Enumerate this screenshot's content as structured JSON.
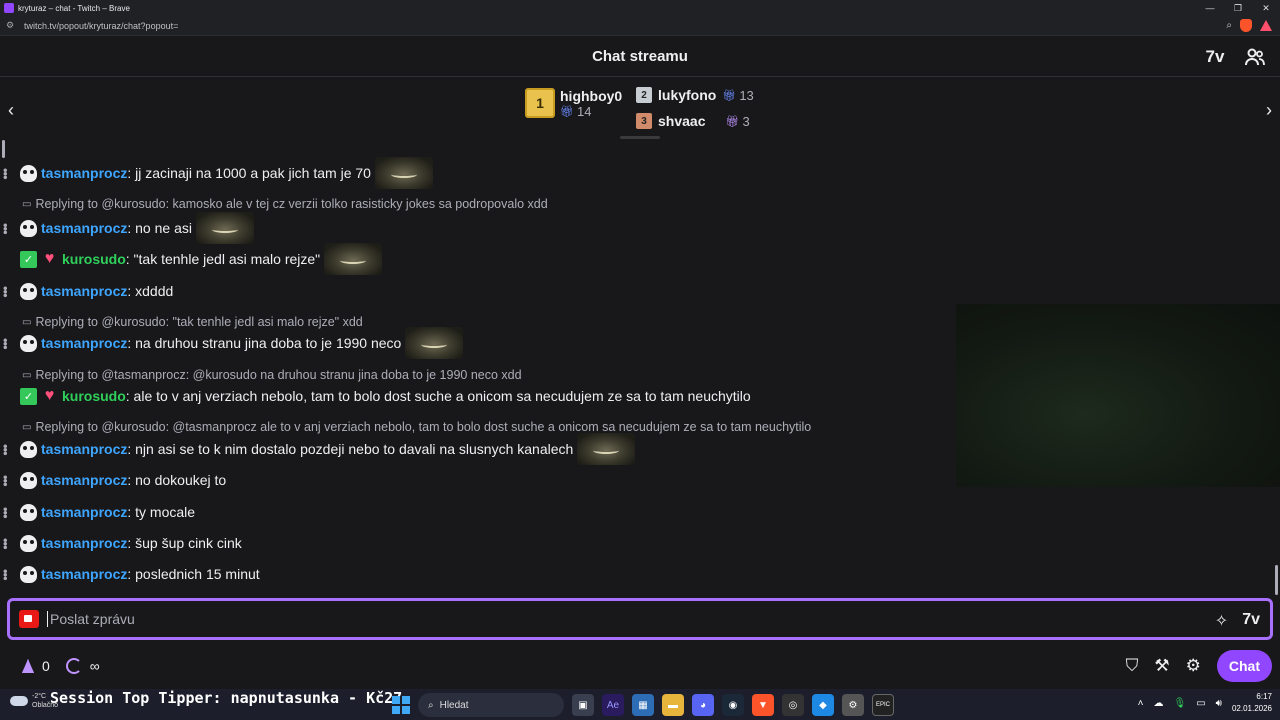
{
  "window": {
    "title": "kryturaz – chat - Twitch – Brave",
    "url": "twitch.tv/popout/kryturaz/chat?popout="
  },
  "header": {
    "title": "Chat streamu"
  },
  "leaderboard": {
    "first": {
      "rank": "1",
      "name": "highboy0",
      "count": "14"
    },
    "second": {
      "rank": "2",
      "name": "lukyfono",
      "count": "13"
    },
    "third": {
      "rank": "3",
      "name": "shvaac",
      "count": "3"
    }
  },
  "messages": [
    {
      "type": "msg",
      "user": "tasmanprocz",
      "text": ": jj zacinaji na 1000 a pak jich tam je 70",
      "emote": true
    },
    {
      "type": "reply",
      "text": "Replying to @kurosudo: kamosko ale v tej cz verzii tolko rasisticky jokes sa podropovalo xdd"
    },
    {
      "type": "msg",
      "user": "tasmanprocz",
      "text": ": no ne asi",
      "emote": true
    },
    {
      "type": "msg",
      "user": "kurosudo",
      "text": ": \"tak tenhle jedl asi malo rejze\"",
      "emote": true
    },
    {
      "type": "msg",
      "user": "tasmanprocz",
      "text": ": xdddd",
      "emote": false
    },
    {
      "type": "reply",
      "text": "Replying to @kurosudo: \"tak tenhle jedl asi malo rejze\" xdd"
    },
    {
      "type": "msg",
      "user": "tasmanprocz",
      "text": ": na druhou stranu jina doba to je 1990 neco",
      "emote": true
    },
    {
      "type": "reply",
      "text": "Replying to @tasmanprocz: @kurosudo na druhou stranu jina doba to je 1990 neco xdd"
    },
    {
      "type": "msg",
      "user": "kurosudo",
      "text": ": ale to v anj verziach nebolo, tam to bolo dost suche a onicom sa necudujem ze sa to tam neuchytilo",
      "emote": false
    },
    {
      "type": "reply",
      "text": "Replying to @kurosudo: @tasmanprocz ale to v anj verziach nebolo, tam to bolo dost suche a onicom sa necudujem ze sa to tam neuchytilo"
    },
    {
      "type": "msg",
      "user": "tasmanprocz",
      "text": ": njn asi se to k nim dostalo pozdeji nebo to davali na slusnych kanalech",
      "emote": true
    },
    {
      "type": "msg",
      "user": "tasmanprocz",
      "text": ": no dokoukej to",
      "emote": false
    },
    {
      "type": "msg",
      "user": "tasmanprocz",
      "text": ": ty mocale",
      "emote": false
    },
    {
      "type": "msg",
      "user": "tasmanprocz",
      "text": ": šup šup cink cink",
      "emote": false
    },
    {
      "type": "msg",
      "user": "tasmanprocz",
      "text": ": poslednich 15 minut",
      "emote": false
    }
  ],
  "input": {
    "placeholder": "Poslat zprávu"
  },
  "bottom": {
    "points": "0",
    "infinity": "∞",
    "chat_button": "Chat"
  },
  "taskbar": {
    "temperature": "-2°C",
    "weather": "Oblačno",
    "tipper": "Session Top Tipper: napnutasunka - Kč27",
    "search": "Hledat",
    "time": "6:17",
    "date": "02.01.2026"
  },
  "colors": {
    "accent": "#9147ff",
    "username_blue": "#3ea6ff",
    "username_green": "#2fd05a",
    "background": "#18181b"
  }
}
